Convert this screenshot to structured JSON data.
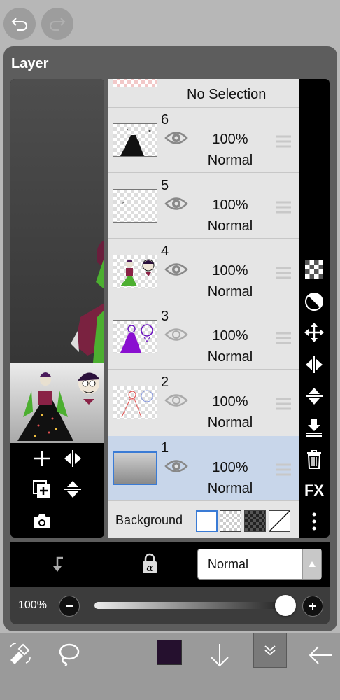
{
  "panel": {
    "title": "Layer"
  },
  "selection_row": {
    "label": "No Selection"
  },
  "layers": [
    {
      "number": "6",
      "opacity": "100%",
      "blend": "Normal",
      "visible": true,
      "selected": false
    },
    {
      "number": "5",
      "opacity": "100%",
      "blend": "Normal",
      "visible": true,
      "selected": false
    },
    {
      "number": "4",
      "opacity": "100%",
      "blend": "Normal",
      "visible": true,
      "selected": false
    },
    {
      "number": "3",
      "opacity": "100%",
      "blend": "Normal",
      "visible": false,
      "selected": false
    },
    {
      "number": "2",
      "opacity": "100%",
      "blend": "Normal",
      "visible": false,
      "selected": false
    },
    {
      "number": "1",
      "opacity": "100%",
      "blend": "Normal",
      "visible": true,
      "selected": true
    }
  ],
  "background": {
    "label": "Background"
  },
  "side_toolbar": {
    "fx_label": "FX"
  },
  "blend_bar": {
    "mode": "Normal"
  },
  "opacity_bar": {
    "value": "100%",
    "slider_level": 1.0
  },
  "bottom": {
    "color": "#25102e"
  },
  "colors": {
    "accent": "#3a7bd5",
    "selected_row": "#c8d6ea"
  }
}
